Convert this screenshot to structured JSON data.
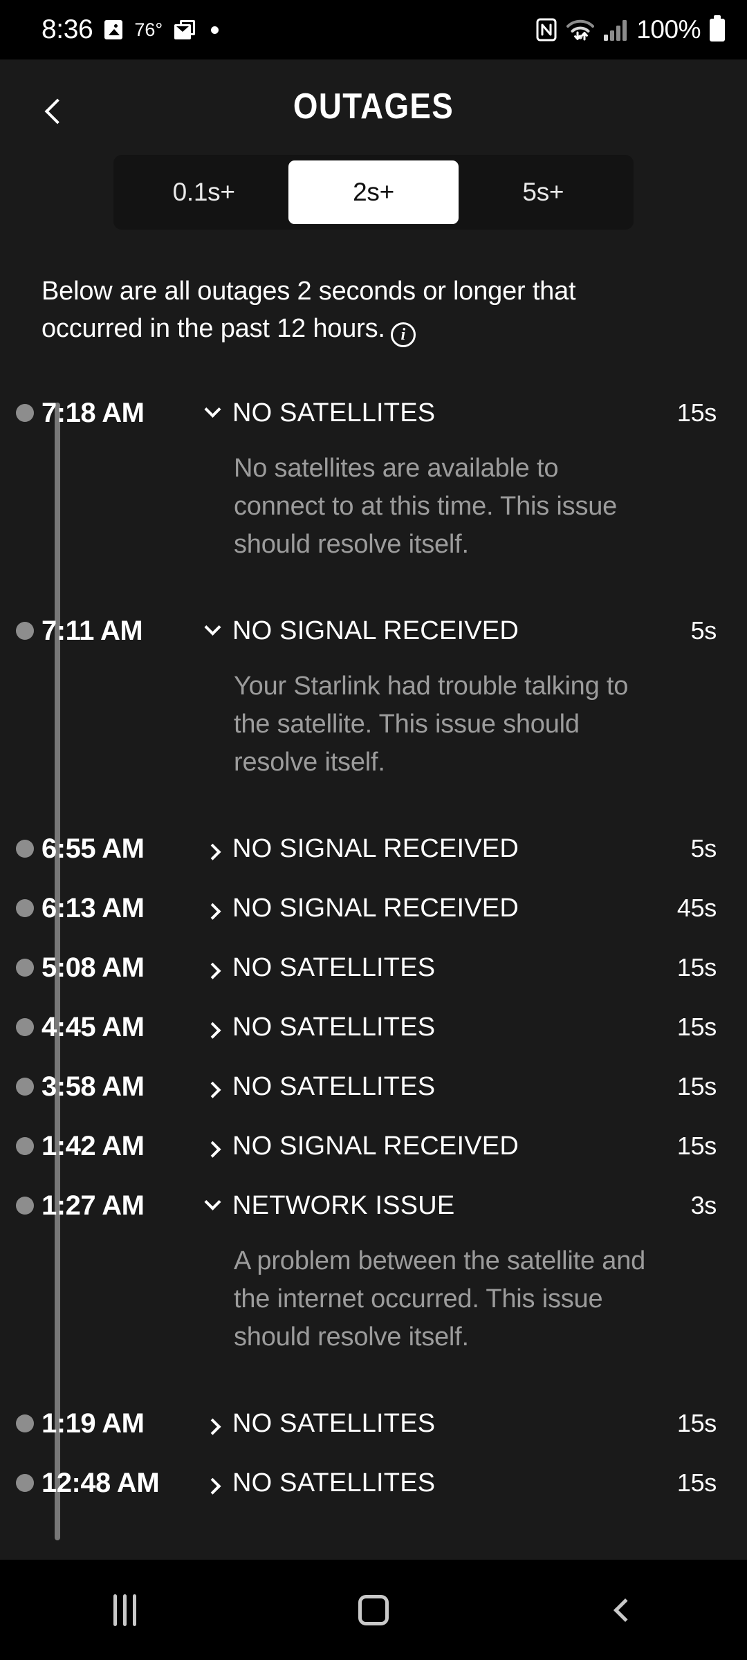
{
  "status_bar": {
    "clock": "8:36",
    "temperature": "76°",
    "battery_percent": "100%",
    "icons": [
      "photo-icon",
      "mail-icon",
      "notification-dot-icon",
      "nfc-icon",
      "wifi-icon",
      "cellular-signal-icon",
      "battery-icon"
    ]
  },
  "app_bar": {
    "title": "OUTAGES",
    "back_label": "back-chevron-icon"
  },
  "filter": {
    "options": [
      {
        "label": "0.1s+",
        "selected": false
      },
      {
        "label": "2s+",
        "selected": true
      },
      {
        "label": "5s+",
        "selected": false
      }
    ]
  },
  "description": {
    "text": "Below are all outages 2 seconds or longer that occurred in the past 12 hours.",
    "info_glyph": "i"
  },
  "outages": [
    {
      "time": "7:18 AM",
      "type": "NO SATELLITES",
      "duration": "15s",
      "expanded": true,
      "detail": "No satellites are available to connect to at this time. This issue should resolve itself."
    },
    {
      "time": "7:11 AM",
      "type": "NO SIGNAL RECEIVED",
      "duration": "5s",
      "expanded": true,
      "detail": "Your Starlink had trouble talking to the satellite. This issue should resolve itself."
    },
    {
      "time": "6:55 AM",
      "type": "NO SIGNAL RECEIVED",
      "duration": "5s",
      "expanded": false,
      "detail": ""
    },
    {
      "time": "6:13 AM",
      "type": "NO SIGNAL RECEIVED",
      "duration": "45s",
      "expanded": false,
      "detail": ""
    },
    {
      "time": "5:08 AM",
      "type": "NO SATELLITES",
      "duration": "15s",
      "expanded": false,
      "detail": ""
    },
    {
      "time": "4:45 AM",
      "type": "NO SATELLITES",
      "duration": "15s",
      "expanded": false,
      "detail": ""
    },
    {
      "time": "3:58 AM",
      "type": "NO SATELLITES",
      "duration": "15s",
      "expanded": false,
      "detail": ""
    },
    {
      "time": "1:42 AM",
      "type": "NO SIGNAL RECEIVED",
      "duration": "15s",
      "expanded": false,
      "detail": ""
    },
    {
      "time": "1:27 AM",
      "type": "NETWORK ISSUE",
      "duration": "3s",
      "expanded": true,
      "detail": "A problem between the satellite and the internet occurred. This issue should resolve itself."
    },
    {
      "time": "1:19 AM",
      "type": "NO SATELLITES",
      "duration": "15s",
      "expanded": false,
      "detail": ""
    },
    {
      "time": "12:48 AM",
      "type": "NO SATELLITES",
      "duration": "15s",
      "expanded": false,
      "detail": ""
    }
  ],
  "nav_bar": {
    "recents_label": "recents-icon",
    "home_label": "home-icon",
    "back_label": "back-icon"
  },
  "colors": {
    "app_background": "#1a1a1a",
    "system_background": "#000000",
    "accent_selected": "#ffffff",
    "detail_text": "#9c9c9c",
    "timeline": "#8d8d8d"
  }
}
